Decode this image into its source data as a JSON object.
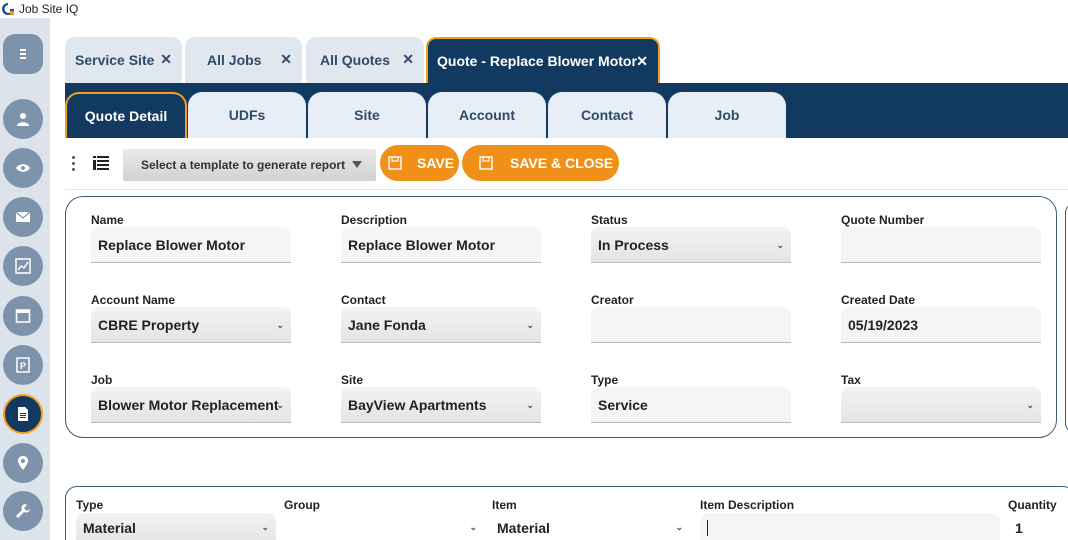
{
  "app": {
    "title": "Job Site IQ"
  },
  "tabs": [
    {
      "label": "Service Site",
      "close": "✕"
    },
    {
      "label": "All Jobs",
      "close": "✕"
    },
    {
      "label": "All Quotes",
      "close": "✕"
    },
    {
      "label": "Quote - Replace Blower Motor",
      "close": "✕",
      "active": true
    }
  ],
  "subtabs": [
    {
      "label": "Quote Detail",
      "active": true
    },
    {
      "label": "UDFs"
    },
    {
      "label": "Site"
    },
    {
      "label": "Account"
    },
    {
      "label": "Contact"
    },
    {
      "label": "Job"
    }
  ],
  "toolbar": {
    "template_placeholder": "Select a template to generate report",
    "save_label": "SAVE",
    "save_close_label": "SAVE & CLOSE"
  },
  "sidebar": {
    "items": [
      {
        "icon": "user-icon"
      },
      {
        "icon": "eye-icon"
      },
      {
        "icon": "mail-icon"
      },
      {
        "icon": "chart-icon"
      },
      {
        "icon": "calendar-icon"
      },
      {
        "icon": "purchase-order-icon"
      },
      {
        "icon": "document-icon",
        "active": true
      },
      {
        "icon": "location-pin-icon"
      },
      {
        "icon": "wrench-icon"
      }
    ]
  },
  "form": {
    "name": {
      "label": "Name",
      "value": "Replace Blower Motor"
    },
    "description": {
      "label": "Description",
      "value": "Replace Blower Motor"
    },
    "status": {
      "label": "Status",
      "value": "In Process"
    },
    "quote_number": {
      "label": "Quote Number",
      "value": ""
    },
    "account_name": {
      "label": "Account Name",
      "value": "CBRE Property"
    },
    "contact": {
      "label": "Contact",
      "value": "Jane Fonda"
    },
    "creator": {
      "label": "Creator",
      "value": ""
    },
    "created_date": {
      "label": "Created Date",
      "value": "05/19/2023"
    },
    "job": {
      "label": "Job",
      "value": "Blower Motor Replacement"
    },
    "site": {
      "label": "Site",
      "value": "BayView Apartments"
    },
    "type": {
      "label": "Type",
      "value": "Service"
    },
    "tax": {
      "label": "Tax",
      "value": ""
    }
  },
  "line_item": {
    "type": {
      "label": "Type",
      "value": "Material"
    },
    "group": {
      "label": "Group",
      "value": ""
    },
    "item": {
      "label": "Item",
      "value": "Material"
    },
    "item_description": {
      "label": "Item Description",
      "value": ""
    },
    "quantity": {
      "label": "Quantity",
      "value": "1"
    }
  },
  "colors": {
    "navy": "#123a60",
    "accent": "#f09018",
    "sidebar_button": "#7d93ac"
  }
}
